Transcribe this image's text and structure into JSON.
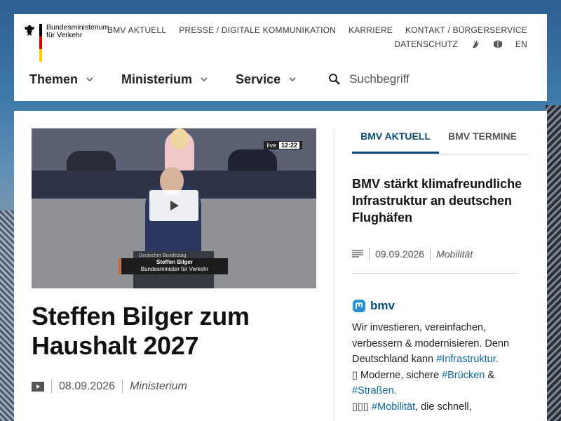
{
  "header": {
    "logo_lines": [
      "Bundesministerium",
      "für Verkehr"
    ],
    "top_links_row1": [
      "BMV AKTUELL",
      "PRESSE / DIGITALE KOMMUNIKATION",
      "KARRIERE",
      "KONTAKT / BÜRGERSERVICE"
    ],
    "top_links_row2_text": "DATENSCHUTZ",
    "lang": "EN",
    "main_nav": [
      {
        "label": "Themen"
      },
      {
        "label": "Ministerium"
      },
      {
        "label": "Service"
      }
    ],
    "search_placeholder": "Suchbegriff"
  },
  "video": {
    "live_label": "live",
    "time": "12:22",
    "lower_third_org": "Deutscher Bundestag",
    "lower_third_name": "Steffen Bilger",
    "lower_third_role": "Bundesminister für Verkehr"
  },
  "article": {
    "title": "Steffen Bilger zum Haushalt 2027",
    "date": "08.09.2026",
    "category": "Ministerium"
  },
  "tabs": [
    {
      "label": "BMV AKTUELL",
      "active": true
    },
    {
      "label": "BMV TERMINE",
      "active": false
    }
  ],
  "news": {
    "title": "BMV stärkt klimafreundliche Infrastruktur an deutschen Flughäfen",
    "date": "09.09.2026",
    "category": "Mobilität"
  },
  "social": {
    "account": "bmv",
    "text_1": "Wir investieren, vereinfachen, verbessern & modernisieren. Denn Deutschland kann ",
    "tag_1": "#Infrastruktur.",
    "text_2": " Moderne, sichere ",
    "tag_2": "#Brücken",
    "text_3": " & ",
    "tag_3": "#Straßen.",
    "text_4": " ",
    "tag_4": "#Mobilität",
    "text_5": ", die schnell,"
  },
  "colors": {
    "accent": "#0b4d7a",
    "hashtag": "#0b6aa6"
  }
}
